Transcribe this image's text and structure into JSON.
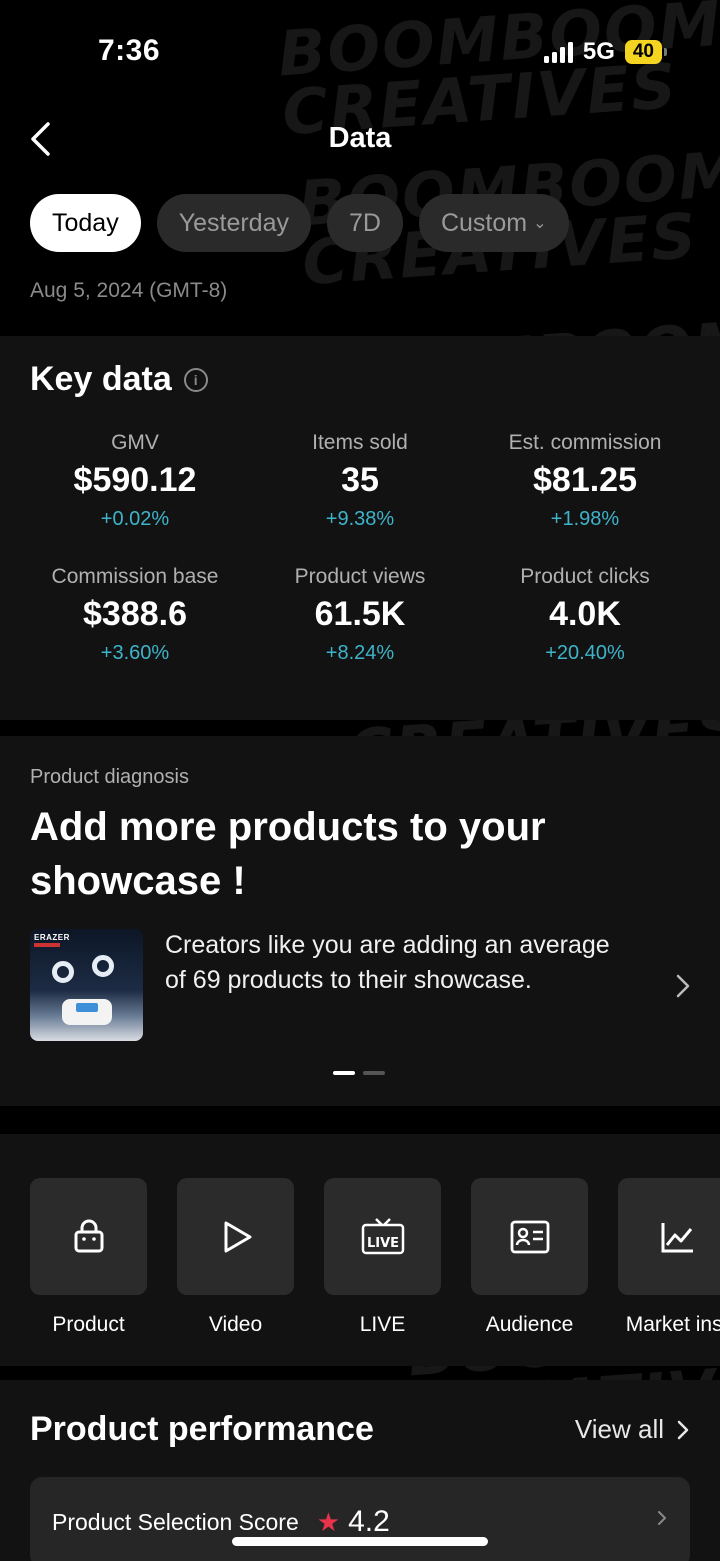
{
  "status_bar": {
    "time": "7:36",
    "network": "5G",
    "battery": "40"
  },
  "header": {
    "title": "Data"
  },
  "tabs": [
    {
      "label": "Today",
      "active": true
    },
    {
      "label": "Yesterday",
      "active": false
    },
    {
      "label": "7D",
      "active": false
    },
    {
      "label": "Custom",
      "active": false
    }
  ],
  "date_label": "Aug 5, 2024 (GMT-8)",
  "key_data": {
    "title": "Key data",
    "metrics": [
      {
        "label": "GMV",
        "value": "$590.12",
        "delta": "+0.02%"
      },
      {
        "label": "Items sold",
        "value": "35",
        "delta": "+9.38%"
      },
      {
        "label": "Est. commission",
        "value": "$81.25",
        "delta": "+1.98%"
      },
      {
        "label": "Commission base",
        "value": "$388.6",
        "delta": "+3.60%"
      },
      {
        "label": "Product views",
        "value": "61.5K",
        "delta": "+8.24%"
      },
      {
        "label": "Product clicks",
        "value": "4.0K",
        "delta": "+20.40%"
      }
    ]
  },
  "diagnosis": {
    "label": "Product diagnosis",
    "title": "Add more products to your showcase !",
    "thumb_brand": "ERAZER",
    "text": "Creators like you are adding an average of 69 products to their showcase."
  },
  "nav": [
    {
      "label": "Product",
      "icon": "shopping-bag-icon"
    },
    {
      "label": "Video",
      "icon": "play-icon"
    },
    {
      "label": "LIVE",
      "icon": "live-tv-icon"
    },
    {
      "label": "Audience",
      "icon": "id-card-icon"
    },
    {
      "label": "Market insi",
      "icon": "line-chart-icon"
    }
  ],
  "performance": {
    "title": "Product performance",
    "view_all": "View all",
    "score_label": "Product Selection Score",
    "score_value": "4.2"
  },
  "watermark": {
    "line1": "BOOMBOOM",
    "line2": "CREATIVES"
  },
  "colors": {
    "accent_delta": "#3fb3c9",
    "star": "#e8334a",
    "battery": "#f5d321"
  }
}
